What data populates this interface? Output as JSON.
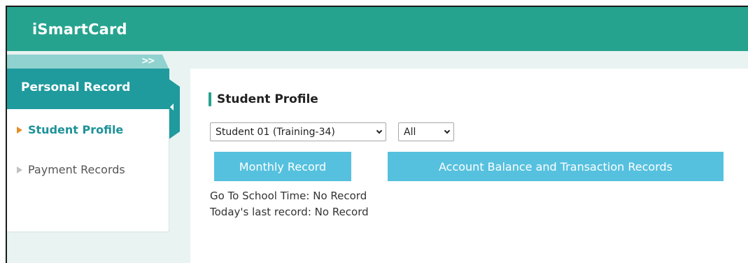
{
  "app": {
    "title": "iSmartCard"
  },
  "sidebar": {
    "expand_icon": ">>",
    "header": "Personal Record",
    "items": [
      {
        "label": "Student Profile",
        "active": true
      },
      {
        "label": "Payment Records",
        "active": false
      }
    ]
  },
  "main": {
    "section_title": "Student Profile",
    "student_select": {
      "value": "Student 01 (Training-34)"
    },
    "period_select": {
      "value": "All"
    },
    "buttons": {
      "monthly": "Monthly Record",
      "balance": "Account Balance and Transaction Records"
    },
    "info": {
      "go_to_school": "Go To School Time: No Record",
      "last_record": "Today's last record: No Record"
    }
  },
  "colors": {
    "header": "#26a38e",
    "sidebar_header": "#1f9a9d",
    "button": "#56c1df",
    "active_item": "#1e9298",
    "active_bullet": "#e0912a"
  }
}
